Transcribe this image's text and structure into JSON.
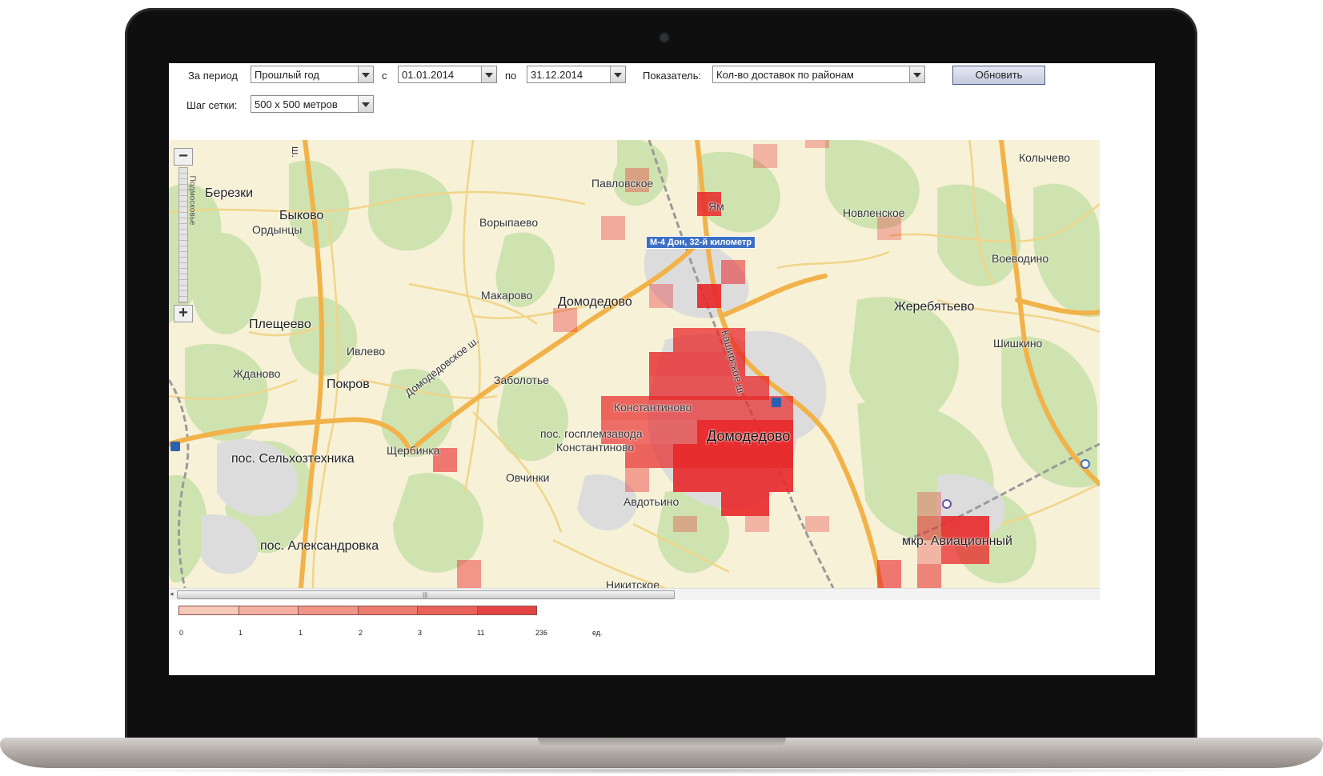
{
  "toolbar": {
    "period_label": "За период",
    "period_value": "Прошлый год",
    "from_label": "с",
    "from_date": "01.01.2014",
    "to_label": "по",
    "to_date": "31.12.2014",
    "metric_label": "Показатель:",
    "metric_value": "Кол-во доставок по районам",
    "refresh_label": "Обновить",
    "grid_label": "Шаг сетки:",
    "grid_value": "500 x 500 метров"
  },
  "map": {
    "zoom_in": "+",
    "zoom_out": "−",
    "zoom_scale_label": "Подмосковье",
    "badge": "М-4 Дон, 32-й километр",
    "places": [
      "Березки",
      "Быково",
      "Ордынцы",
      "Павловское",
      "Ям",
      "Ворыпаево",
      "Новленское",
      "Колычево",
      "Воеводино",
      "Макарово",
      "Домодедово",
      "Плещеево",
      "Ивлево",
      "Жданово",
      "Покров",
      "Заболотье",
      "Жеребятьево",
      "Шишкино",
      "Константиново",
      "пос. госплемзавода",
      "Константиново",
      "Домодедово",
      "пос. Сельхозтехника",
      "Щербинка",
      "Овчинки",
      "Авдотьино",
      "пос. Александровка",
      "мкр. Авиационный",
      "Никитское"
    ],
    "roads": [
      "Домодедовское ш.",
      "Каширское ш.",
      "ш."
    ],
    "heat_color": "#e8282a"
  },
  "legend": {
    "colors": [
      "#f6c8b8",
      "#f3b0a0",
      "#ef9588",
      "#ec7c70",
      "#e9625a",
      "#e54444"
    ],
    "ticks": [
      "0",
      "1",
      "1",
      "2",
      "3",
      "11",
      "236"
    ],
    "unit": "ед."
  }
}
